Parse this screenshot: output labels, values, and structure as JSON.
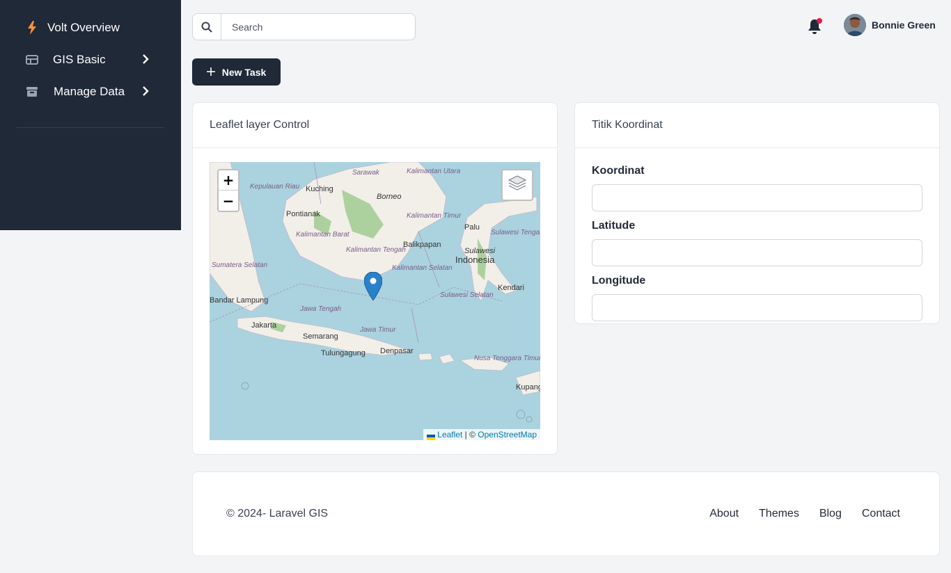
{
  "sidebar": {
    "brand": "Volt Overview",
    "items": [
      {
        "label": "GIS Basic",
        "icon": "table-icon"
      },
      {
        "label": "Manage Data",
        "icon": "archive-icon"
      }
    ]
  },
  "topbar": {
    "search_placeholder": "Search",
    "user_name": "Bonnie Green"
  },
  "actions": {
    "new_task_label": "New Task"
  },
  "map_card": {
    "title": "Leaflet layer Control",
    "zoom_in": "+",
    "zoom_out": "−",
    "attribution_leaflet": "Leaflet",
    "attribution_sep": " | © ",
    "attribution_osm": "OpenStreetMap",
    "labels": {
      "borneo": "Borneo",
      "kuching": "Kuching",
      "pontianak": "Pontianak",
      "balikpapan": "Balikpapan",
      "palu": "Palu",
      "indonesia": "Indonesia",
      "sulawesi": "Sulawesi",
      "kendari": "Kendari",
      "bandar_lampung": "Bandar Lampung",
      "jakarta": "Jakarta",
      "semarang": "Semarang",
      "tulungagung": "Tulungagung",
      "denpasar": "Denpasar",
      "kupang": "Kupang",
      "sarawak": "Sarawak",
      "kalimantan_utara": "Kalimantan Utara",
      "kalimantan_timur": "Kalimantan Timur",
      "kalimantan_barat": "Kalimantan Barat",
      "kalimantan_tengah": "Kalimantan Tengah",
      "kalimantan_selatan": "Kalimantan Selatan",
      "sulawesi_tengah": "Sulawesi Tengah",
      "sulawesi_selatan": "Sulawesi Selatan",
      "jawa_tengah": "Jawa Tengah",
      "jawa_timur": "Jawa Timur",
      "nusa_tenggara_timur": "Nusa Tenggara Timur",
      "sumatera_selatan": "Sumatera Selatan",
      "kepulauan_riau": "Kepulauan Riau"
    }
  },
  "coord_card": {
    "title": "Titik Koordinat",
    "fields": [
      {
        "label": "Koordinat",
        "value": ""
      },
      {
        "label": "Latitude",
        "value": ""
      },
      {
        "label": "Longitude",
        "value": ""
      }
    ]
  },
  "footer": {
    "copyright": "© 2024- Laravel GIS",
    "links": [
      "About",
      "Themes",
      "Blog",
      "Contact"
    ]
  },
  "colors": {
    "sidebar_bg": "#1f2937",
    "page_bg": "#f2f4f6",
    "brand_icon": "#fb923c",
    "notification_dot": "#e11d48",
    "map_water": "#aad3df",
    "marker": "#2a81cb"
  }
}
